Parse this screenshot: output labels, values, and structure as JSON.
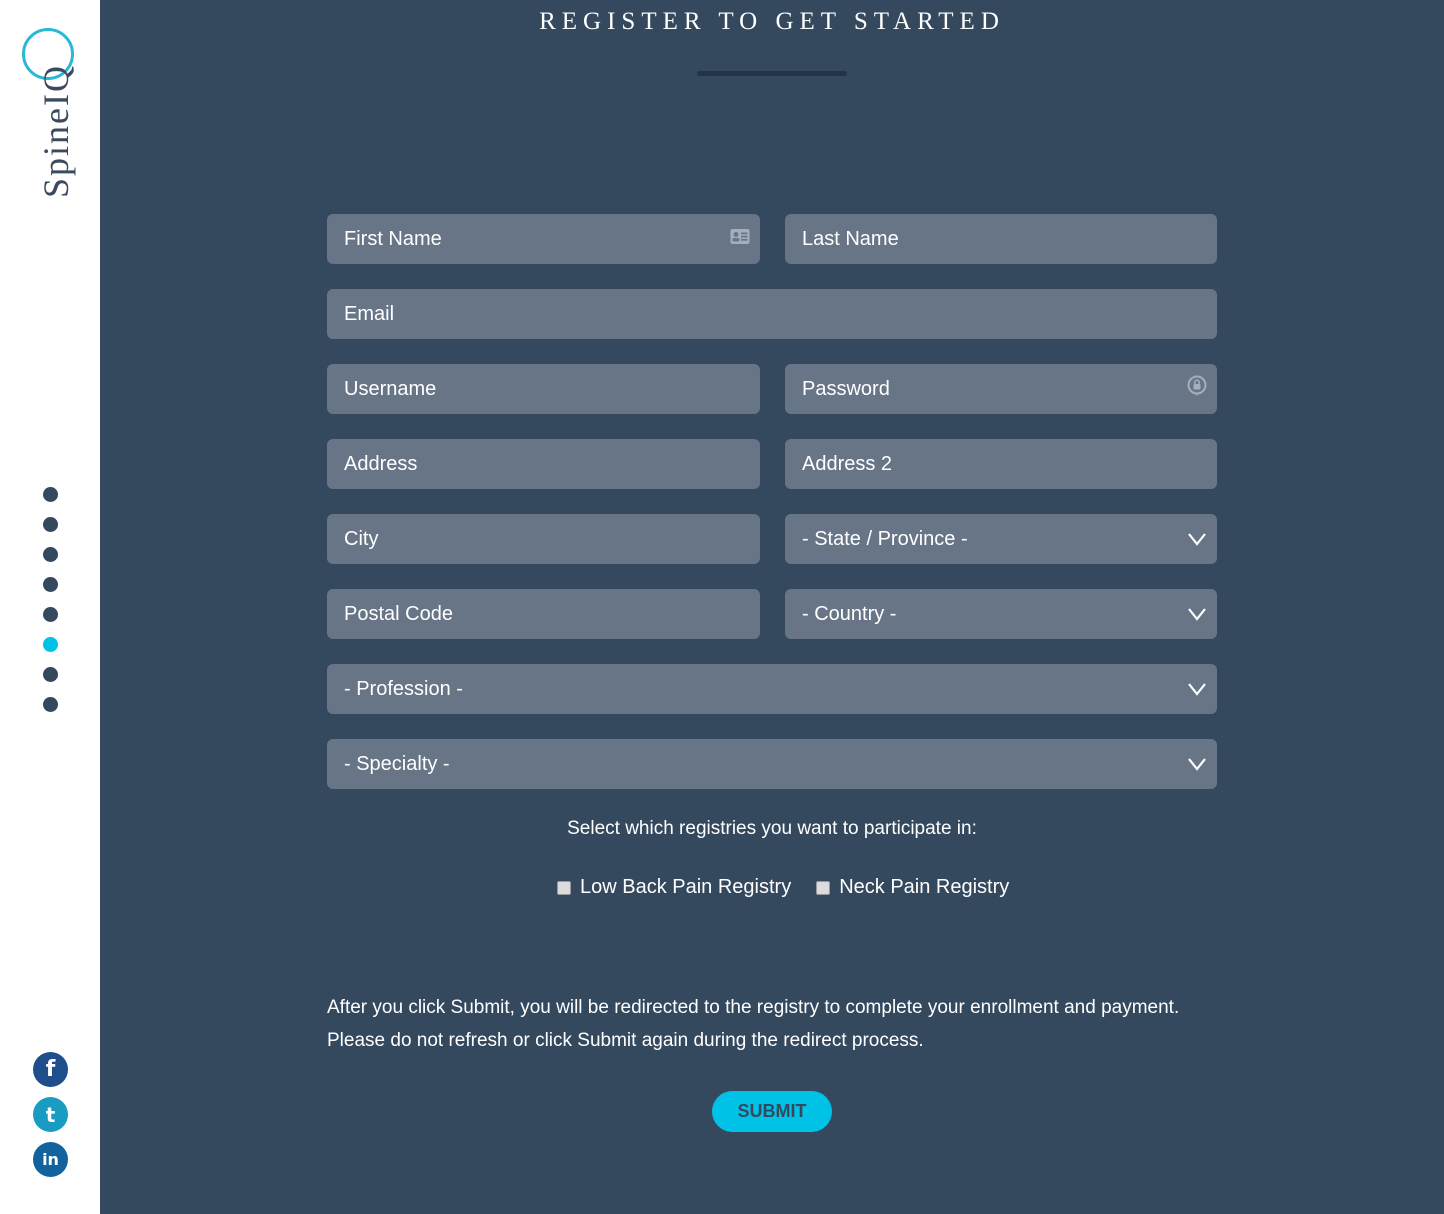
{
  "brand": {
    "logo_text": "SpineIQ",
    "accent": "#00c2e6"
  },
  "header": {
    "title": "REGISTER TO GET STARTED"
  },
  "nav_dots": {
    "count": 8,
    "active_index": 5
  },
  "social": [
    {
      "name": "facebook",
      "glyph": "f"
    },
    {
      "name": "twitter",
      "glyph": "t"
    },
    {
      "name": "linkedin",
      "glyph": "in"
    }
  ],
  "form": {
    "first_name": {
      "placeholder": "First Name",
      "value": ""
    },
    "last_name": {
      "placeholder": "Last Name",
      "value": ""
    },
    "email": {
      "placeholder": "Email",
      "value": ""
    },
    "username": {
      "placeholder": "Username",
      "value": ""
    },
    "password": {
      "placeholder": "Password",
      "value": ""
    },
    "address": {
      "placeholder": "Address",
      "value": ""
    },
    "address2": {
      "placeholder": "Address 2",
      "value": ""
    },
    "city": {
      "placeholder": "City",
      "value": ""
    },
    "state": {
      "selected": "- State / Province -"
    },
    "postal_code": {
      "placeholder": "Postal Code",
      "value": ""
    },
    "country": {
      "selected": "- Country -"
    },
    "profession": {
      "selected": "- Profession -"
    },
    "specialty": {
      "selected": "- Specialty -"
    },
    "registries_prompt": "Select which registries you want to participate in:",
    "registries": [
      {
        "label": "Low Back Pain Registry",
        "checked": false
      },
      {
        "label": "Neck Pain Registry",
        "checked": false
      }
    ],
    "notice_line1": "After you click Submit, you will be redirected to the registry to complete your enrollment and payment.",
    "notice_line2": "Please do not refresh or click Submit again during the redirect process.",
    "submit_label": "SUBMIT"
  }
}
